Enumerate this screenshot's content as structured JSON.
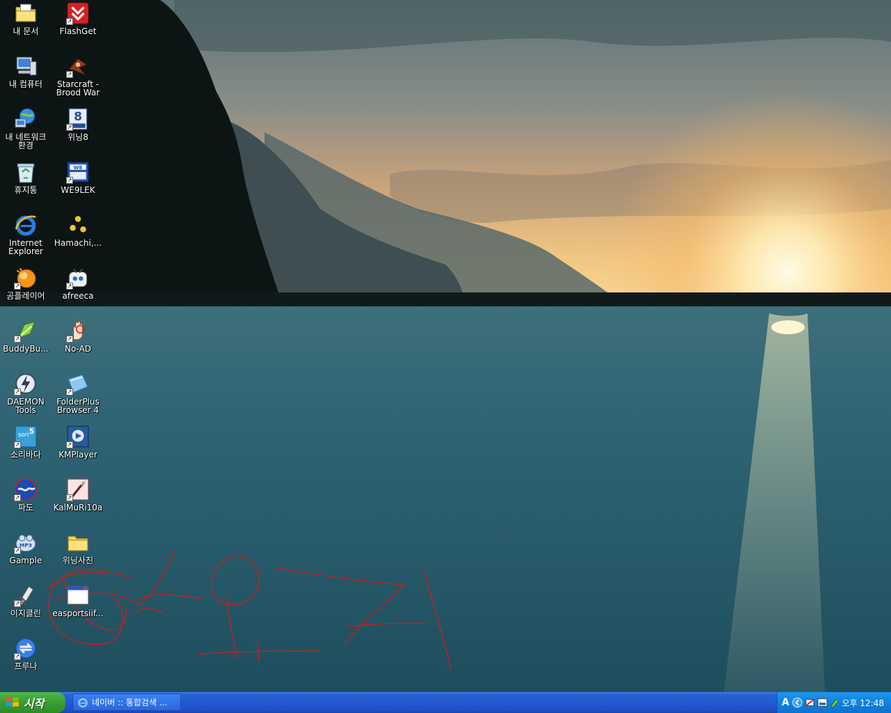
{
  "desktop": {
    "icons": [
      {
        "label": "내 문서",
        "icon": "my-documents-icon"
      },
      {
        "label": "FlashGet",
        "icon": "flashget-icon"
      },
      {
        "label": "내 컴퓨터",
        "icon": "my-computer-icon"
      },
      {
        "label": "Starcraft -\nBrood War",
        "icon": "starcraft-icon"
      },
      {
        "label": "내 네트워크\n환경",
        "icon": "network-places-icon"
      },
      {
        "label": "위닝8",
        "icon": "winning8-icon"
      },
      {
        "label": "휴지통",
        "icon": "recycle-bin-icon"
      },
      {
        "label": "WE9LEK",
        "icon": "we9lek-icon"
      },
      {
        "label": "Internet\nExplorer",
        "icon": "internet-explorer-icon"
      },
      {
        "label": "Hamachi,...",
        "icon": "hamachi-icon"
      },
      {
        "label": "곰플레이어",
        "icon": "gom-player-icon"
      },
      {
        "label": "afreeca",
        "icon": "afreeca-icon"
      },
      {
        "label": "BuddyBu...",
        "icon": "buddybuddy-icon"
      },
      {
        "label": "No-AD",
        "icon": "no-ad-icon"
      },
      {
        "label": "DAEMON\nTools",
        "icon": "daemon-tools-icon"
      },
      {
        "label": "FolderPlus\nBrowser 4",
        "icon": "folderplus-icon"
      },
      {
        "label": "소리바다",
        "icon": "soribada-icon"
      },
      {
        "label": "KMPlayer",
        "icon": "kmplayer-icon"
      },
      {
        "label": "파도",
        "icon": "pado-icon"
      },
      {
        "label": "KalMuRi10a",
        "icon": "kalmuri-icon"
      },
      {
        "label": "Gample",
        "icon": "gample-icon"
      },
      {
        "label": "위닝사진",
        "icon": "folder-icon"
      },
      {
        "label": "이지클린",
        "icon": "easyclean-icon"
      },
      {
        "label": "easportsiif...",
        "icon": "window-icon"
      },
      {
        "label": "프루나",
        "icon": "pruna-icon"
      }
    ]
  },
  "taskbar": {
    "start_label": "시작",
    "task_item_label": "네이버 :: 통합검색 ...",
    "ime_indicator": "A",
    "clock": "오후 12:48"
  },
  "colors": {
    "taskbar_blue": "#2459d0",
    "start_green": "#3a9d35",
    "tray_blue": "#0f83e0",
    "scribble_red": "#d81818"
  }
}
